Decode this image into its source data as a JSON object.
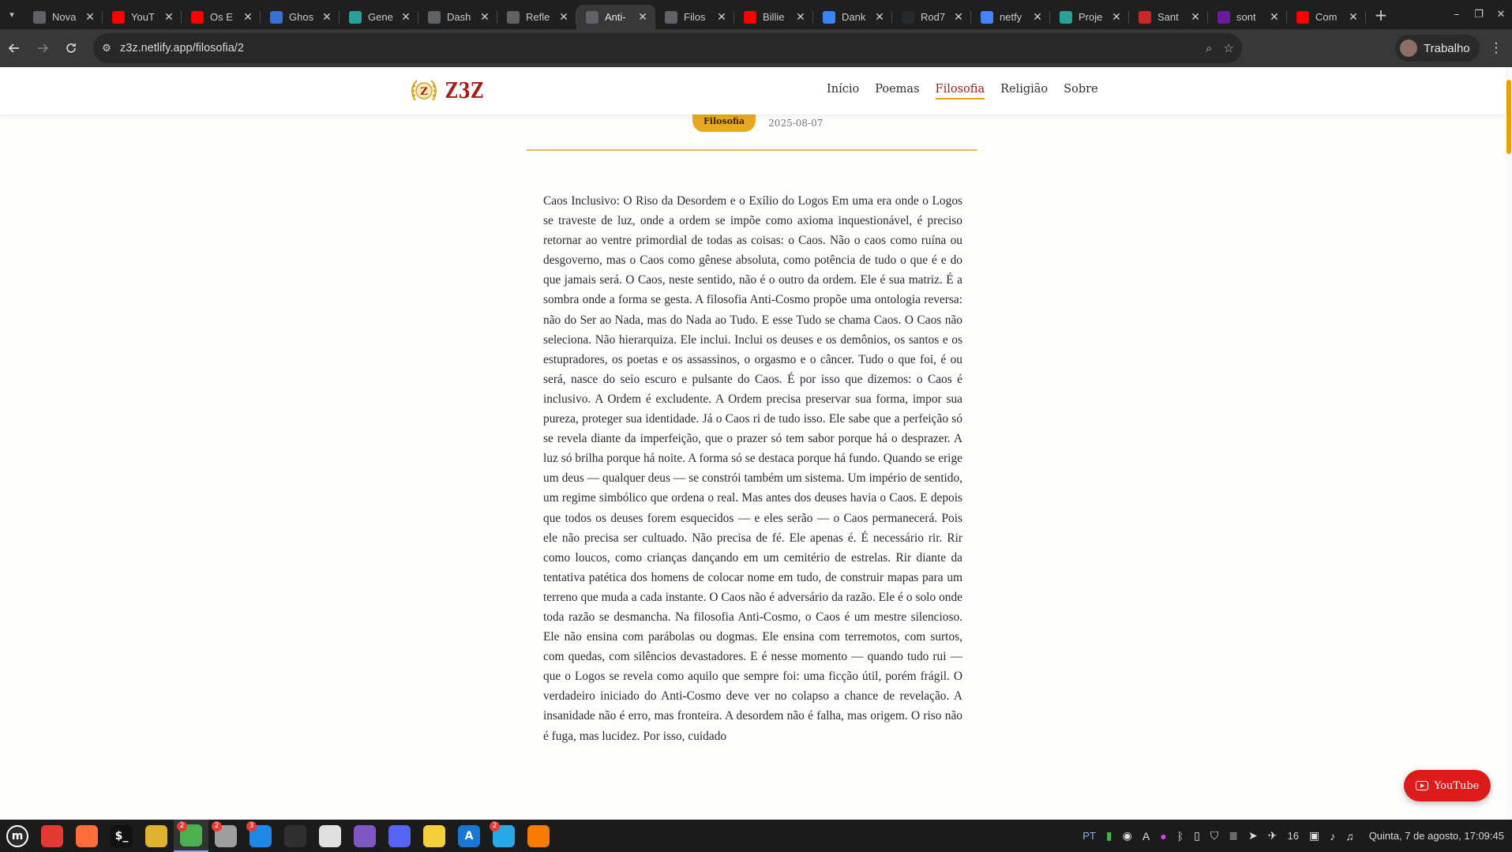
{
  "browser": {
    "tabs": [
      {
        "title": "Nova",
        "icon": "chrome-icon",
        "color": "#5f6368",
        "active": false
      },
      {
        "title": "YouT",
        "icon": "youtube-icon",
        "color": "#ff0000",
        "active": false
      },
      {
        "title": "Os E",
        "icon": "youtube-icon",
        "color": "#ff0000",
        "active": false
      },
      {
        "title": "Ghos",
        "icon": "ghost-icon",
        "color": "#3b6fd1",
        "active": false
      },
      {
        "title": "Gene",
        "icon": "diamond-icon",
        "color": "#2aa198",
        "active": false
      },
      {
        "title": "Dash",
        "icon": "globe-icon",
        "color": "#5f6368",
        "active": false
      },
      {
        "title": "Refle",
        "icon": "openai-icon",
        "color": "#5f6368",
        "active": false
      },
      {
        "title": "Anti-",
        "icon": "globe-icon",
        "color": "#5f6368",
        "active": true
      },
      {
        "title": "Filos",
        "icon": "globe-icon",
        "color": "#5f6368",
        "active": false
      },
      {
        "title": "Billie",
        "icon": "youtube-icon",
        "color": "#ff0000",
        "active": false
      },
      {
        "title": "Dank",
        "icon": "code-icon",
        "color": "#3b82f6",
        "active": false
      },
      {
        "title": "Rod7",
        "icon": "github-icon",
        "color": "#24292e",
        "active": false
      },
      {
        "title": "netfy",
        "icon": "google-icon",
        "color": "#4285f4",
        "active": false
      },
      {
        "title": "Proje",
        "icon": "diamond-icon",
        "color": "#2aa198",
        "active": false
      },
      {
        "title": "Sant",
        "icon": "figure-icon",
        "color": "#c62828",
        "active": false
      },
      {
        "title": "sont",
        "icon": "pen-icon",
        "color": "#6a1b9a",
        "active": false
      },
      {
        "title": "Com",
        "icon": "youtube-icon",
        "color": "#ff0000",
        "active": false
      }
    ],
    "url": "z3z.netlify.app/filosofia/2",
    "profile_name": "Trabalho"
  },
  "site": {
    "brand": "Z3Z",
    "emblem_letter": "Z",
    "nav": [
      {
        "label": "Início",
        "active": false
      },
      {
        "label": "Poemas",
        "active": false
      },
      {
        "label": "Filosofia",
        "active": true
      },
      {
        "label": "Religião",
        "active": false
      },
      {
        "label": "Sobre",
        "active": false
      }
    ],
    "category_badge": "Filosofia",
    "date": "2025-08-07",
    "article_text": "Caos Inclusivo: O Riso da Desordem e o Exílio do Logos Em uma era onde o Logos se traveste de luz, onde a ordem se impõe como axioma inquestionável, é preciso retornar ao ventre primordial de todas as coisas: o Caos. Não o caos como ruína ou desgoverno, mas o Caos como gênese absoluta, como potência de tudo o que é e do que jamais será. O Caos, neste sentido, não é o outro da ordem. Ele é sua matriz. É a sombra onde a forma se gesta. A filosofia Anti-Cosmo propõe uma ontologia reversa: não do Ser ao Nada, mas do Nada ao Tudo. E esse Tudo se chama Caos. O Caos não seleciona. Não hierarquiza. Ele inclui. Inclui os deuses e os demônios, os santos e os estupradores, os poetas e os assassinos, o orgasmo e o câncer. Tudo o que foi, é ou será, nasce do seio escuro e pulsante do Caos. É por isso que dizemos: o Caos é inclusivo. A Ordem é excludente. A Ordem precisa preservar sua forma, impor sua pureza, proteger sua identidade. Já o Caos ri de tudo isso. Ele sabe que a perfeição só se revela diante da imperfeição, que o prazer só tem sabor porque há o desprazer. A luz só brilha porque há noite. A forma só se destaca porque há fundo. Quando se erige um deus — qualquer deus — se constrói também um sistema. Um império de sentido, um regime simbólico que ordena o real. Mas antes dos deuses havia o Caos. E depois que todos os deuses forem esquecidos — e eles serão — o Caos permanecerá. Pois ele não precisa ser cultuado. Não precisa de fé. Ele apenas é. É necessário rir. Rir como loucos, como crianças dançando em um cemitério de estrelas. Rir diante da tentativa patética dos homens de colocar nome em tudo, de construir mapas para um terreno que muda a cada instante. O Caos não é adversário da razão. Ele é o solo onde toda razão se desmancha. Na filosofia Anti-Cosmo, o Caos é um mestre silencioso. Ele não ensina com parábolas ou dogmas. Ele ensina com terremotos, com surtos, com quedas, com silêncios devastadores. E é nesse momento — quando tudo rui — que o Logos se revela como aquilo que sempre foi: uma ficção útil, porém frágil. O verdadeiro iniciado do Anti-Cosmo deve ver no colapso a chance de revelação. A insanidade não é erro, mas fronteira. A desordem não é falha, mas origem. O riso não é fuga, mas lucidez. Por isso, cuidado",
    "youtube_button": "YouTube"
  },
  "taskbar": {
    "apps": [
      {
        "name": "system-menu-icon",
        "glyph": "m",
        "color": "#2b2b2b",
        "badge": ""
      },
      {
        "name": "files-icon",
        "glyph": "",
        "color": "#e53935",
        "badge": ""
      },
      {
        "name": "firefox-icon",
        "glyph": "",
        "color": "#ff6d3a",
        "badge": ""
      },
      {
        "name": "terminal-icon",
        "glyph": "$_",
        "color": "#111111",
        "badge": ""
      },
      {
        "name": "editor-icon",
        "glyph": "",
        "color": "#e0b030",
        "badge": ""
      },
      {
        "name": "chrome-icon",
        "glyph": "",
        "color": "#4caf50",
        "badge": "2"
      },
      {
        "name": "settings-icon",
        "glyph": "",
        "color": "#9e9e9e",
        "badge": "2"
      },
      {
        "name": "vscode-icon",
        "glyph": "",
        "color": "#1e88e5",
        "badge": "3"
      },
      {
        "name": "obs-icon",
        "glyph": "",
        "color": "#303030",
        "badge": ""
      },
      {
        "name": "inkscape-icon",
        "glyph": "",
        "color": "#e0e0e0",
        "badge": ""
      },
      {
        "name": "notes-icon",
        "glyph": "",
        "color": "#7e57c2",
        "badge": ""
      },
      {
        "name": "discord-icon",
        "glyph": "",
        "color": "#5865f2",
        "badge": ""
      },
      {
        "name": "sticky-notes-icon",
        "glyph": "",
        "color": "#f4d03f",
        "badge": ""
      },
      {
        "name": "font-viewer-icon",
        "glyph": "A",
        "color": "#1976d2",
        "badge": ""
      },
      {
        "name": "telegram-icon",
        "glyph": "",
        "color": "#29a9ea",
        "badge": "2"
      },
      {
        "name": "text-editor-icon",
        "glyph": "",
        "color": "#f57c00",
        "badge": ""
      }
    ],
    "keyboard_layout": "PT",
    "volume_level": "16",
    "clock": "Quinta, 7 de agosto, 17:09:45"
  }
}
